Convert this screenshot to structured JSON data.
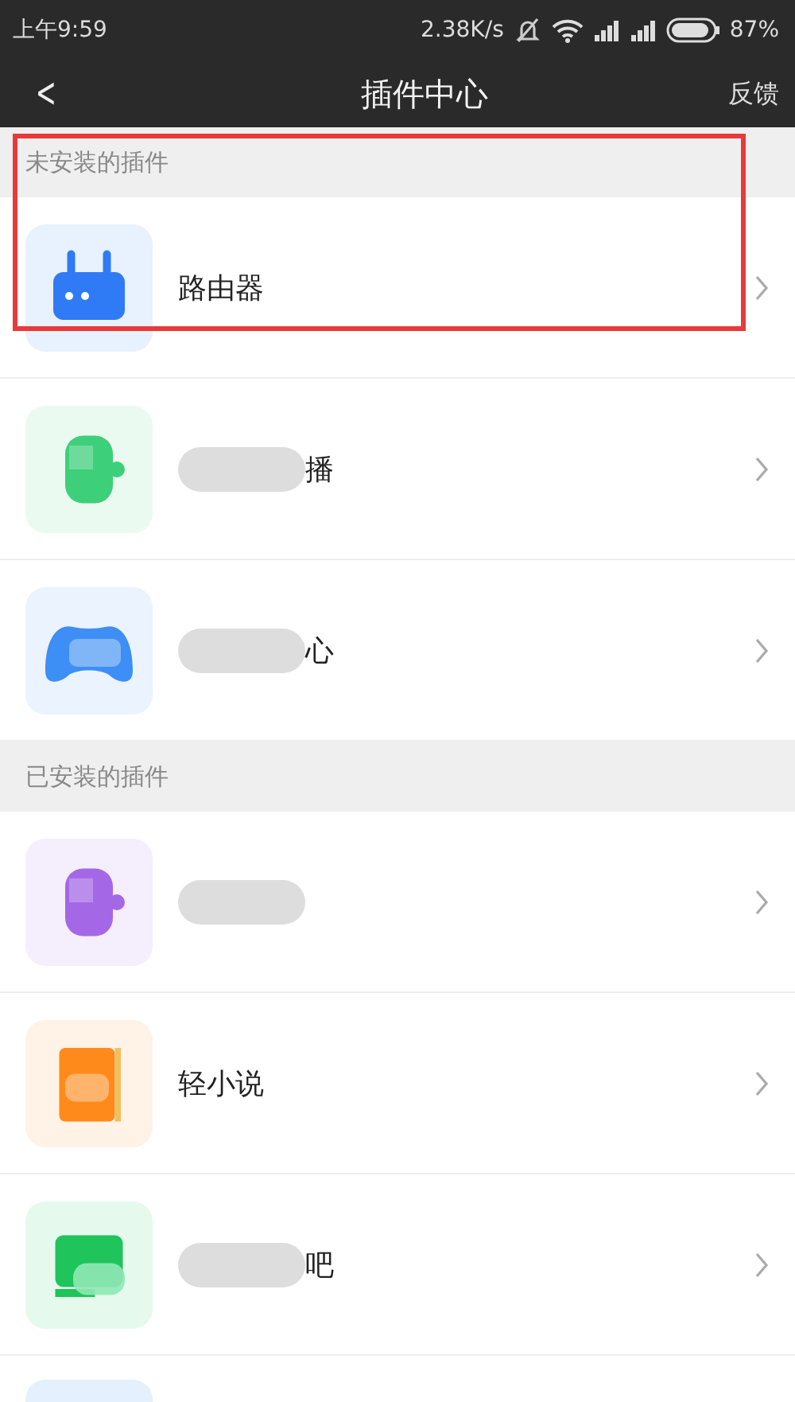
{
  "status_bar": {
    "time": "上午9:59",
    "speed": "2.38K/s",
    "battery": "87%"
  },
  "header": {
    "back": "<",
    "title": "插件中心",
    "action": "反馈"
  },
  "sections": [
    {
      "title": "未安装的插件",
      "highlighted": true,
      "items": [
        {
          "kind": "router",
          "name": "路由器",
          "redacted": false,
          "color": "#2f7bf5"
        },
        {
          "kind": "cup",
          "name": "播",
          "redacted": true,
          "color": "#3ecf7a"
        },
        {
          "kind": "gamepad",
          "name": "心",
          "redacted": true,
          "color": "#3d8ef5"
        }
      ]
    },
    {
      "title": "已安装的插件",
      "highlighted": false,
      "items": [
        {
          "kind": "cup",
          "redacted": true,
          "color": "#a468e6"
        },
        {
          "kind": "book",
          "name": "轻小说",
          "redacted": false,
          "color": "#ff8a1c"
        },
        {
          "kind": "screen",
          "name": "吧",
          "redacted": true,
          "color": "#1fc45a"
        },
        {
          "kind": "partial",
          "redacted": false,
          "color": "#e4f0fd"
        }
      ]
    }
  ]
}
